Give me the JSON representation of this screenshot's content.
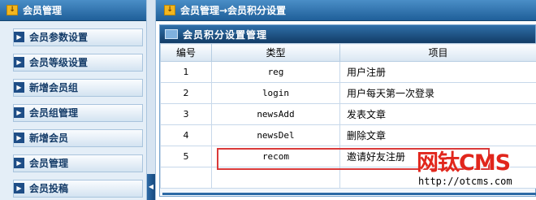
{
  "sidebar": {
    "title": "会员管理",
    "items": [
      {
        "label": "会员参数设置"
      },
      {
        "label": "会员等级设置"
      },
      {
        "label": "新增会员组"
      },
      {
        "label": "会员组管理"
      },
      {
        "label": "新增会员"
      },
      {
        "label": "会员管理"
      },
      {
        "label": "会员投稿"
      }
    ]
  },
  "header": {
    "breadcrumb": "会员管理→会员积分设置"
  },
  "panel": {
    "title": "会员积分设置管理",
    "columns": [
      "编号",
      "类型",
      "项目"
    ],
    "rows": [
      {
        "id": "1",
        "type": "reg",
        "item": "用户注册"
      },
      {
        "id": "2",
        "type": "login",
        "item": "用户每天第一次登录"
      },
      {
        "id": "3",
        "type": "newsAdd",
        "item": "发表文章"
      },
      {
        "id": "4",
        "type": "newsDel",
        "item": "删除文章"
      },
      {
        "id": "5",
        "type": "recom",
        "item": "邀请好友注册"
      }
    ]
  },
  "watermark": {
    "logo": "网钛CMS",
    "url": "http://otcms.com"
  },
  "colors": {
    "header_blue": "#1f5f99",
    "highlight_red": "#d93a3a",
    "watermark_red": "#e1261c"
  }
}
